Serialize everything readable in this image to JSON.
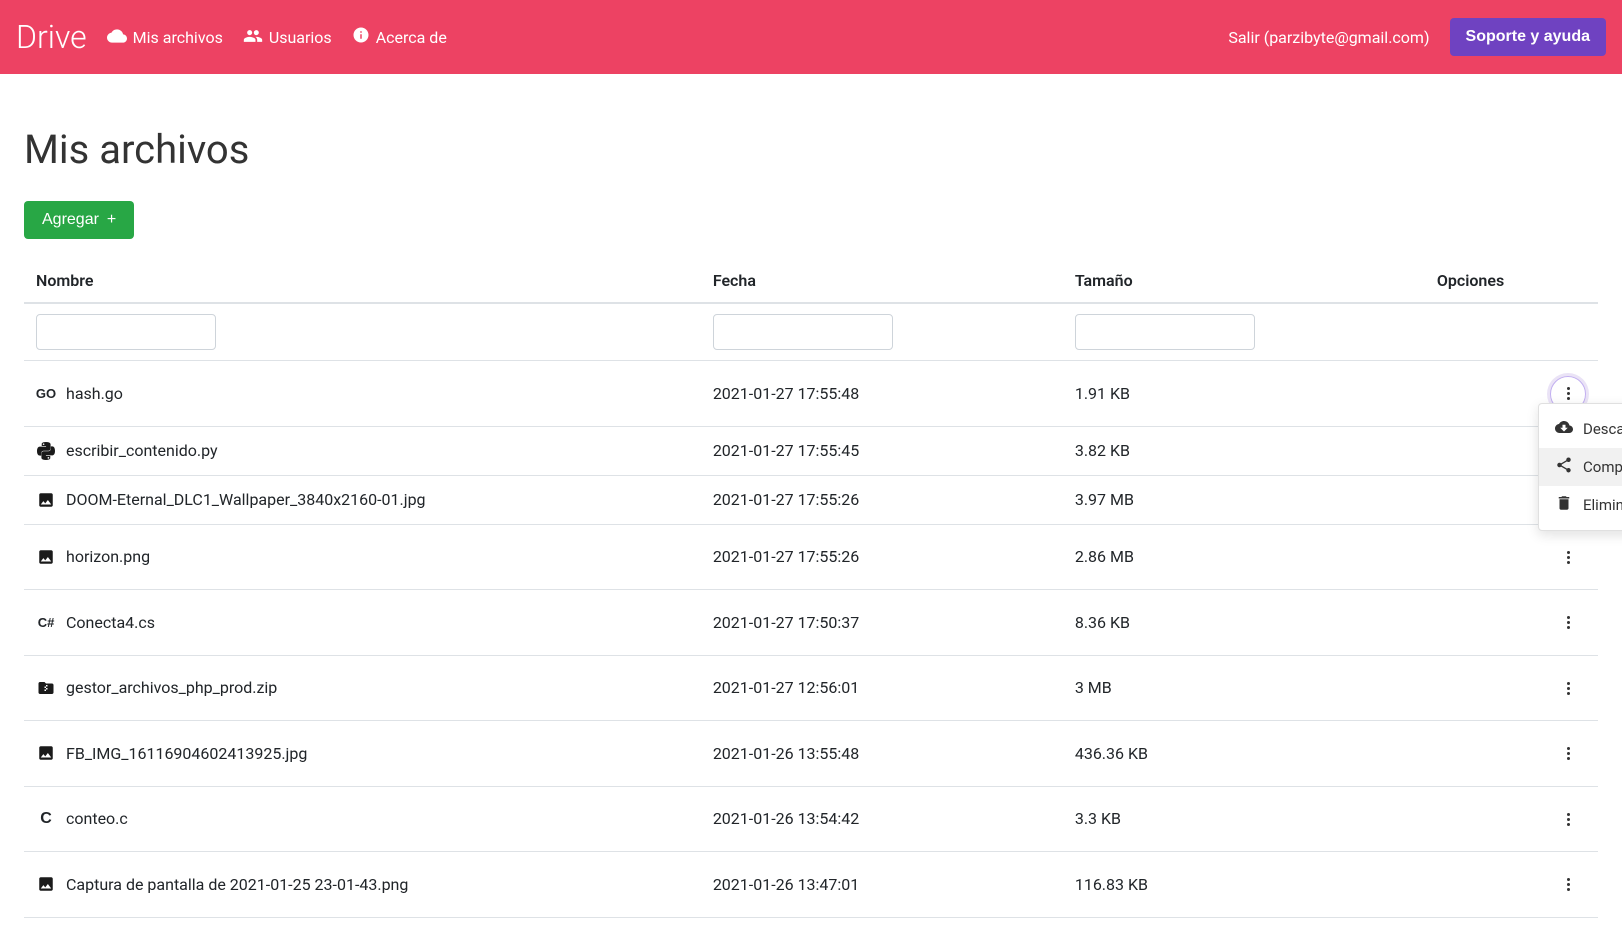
{
  "navbar": {
    "brand": "Drive",
    "links": {
      "myfiles": "Mis archivos",
      "users": "Usuarios",
      "about": "Acerca de"
    },
    "logout_prefix": "Salir",
    "logout_email": "(parzibyte@gmail.com)",
    "support_button": "Soporte y ayuda"
  },
  "page": {
    "title": "Mis archivos",
    "add_button": "Agregar"
  },
  "table": {
    "columns": {
      "name": "Nombre",
      "date": "Fecha",
      "size": "Tamaño",
      "options": "Opciones"
    },
    "rows": [
      {
        "icon": "go",
        "name": "hash.go",
        "date": "2021-01-27 17:55:48",
        "size": "1.91 KB"
      },
      {
        "icon": "python",
        "name": "escribir_contenido.py",
        "date": "2021-01-27 17:55:45",
        "size": "3.82 KB"
      },
      {
        "icon": "image",
        "name": "DOOM-Eternal_DLC1_Wallpaper_3840x2160-01.jpg",
        "date": "2021-01-27 17:55:26",
        "size": "3.97 MB"
      },
      {
        "icon": "image",
        "name": "horizon.png",
        "date": "2021-01-27 17:55:26",
        "size": "2.86 MB"
      },
      {
        "icon": "csharp",
        "name": "Conecta4.cs",
        "date": "2021-01-27 17:50:37",
        "size": "8.36 KB"
      },
      {
        "icon": "zip",
        "name": "gestor_archivos_php_prod.zip",
        "date": "2021-01-27 12:56:01",
        "size": "3 MB"
      },
      {
        "icon": "image",
        "name": "FB_IMG_16116904602413925.jpg",
        "date": "2021-01-26 13:55:48",
        "size": "436.36 KB"
      },
      {
        "icon": "c",
        "name": "conteo.c",
        "date": "2021-01-26 13:54:42",
        "size": "3.3 KB"
      },
      {
        "icon": "image",
        "name": "Captura de pantalla de 2021-01-25 23-01-43.png",
        "date": "2021-01-26 13:47:01",
        "size": "116.83 KB"
      }
    ]
  },
  "dropdown": {
    "download": "Descargar",
    "share": "Compartir",
    "delete": "Eliminar"
  }
}
